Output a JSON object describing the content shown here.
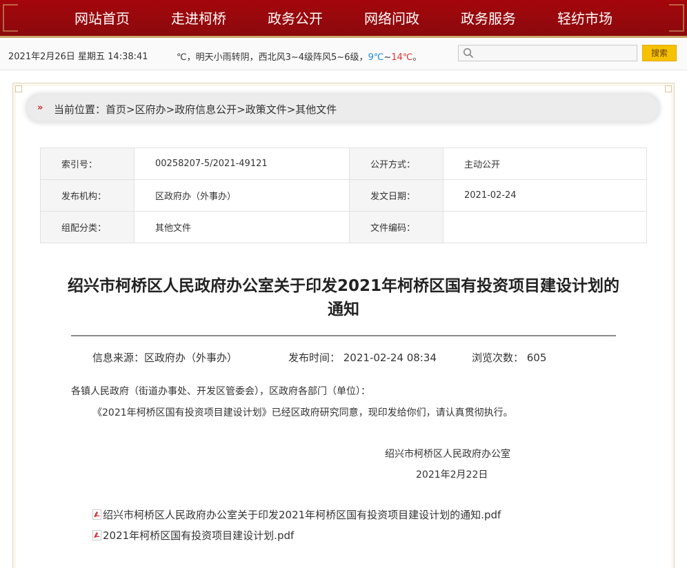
{
  "nav": {
    "items": [
      "网站首页",
      "走进柯桥",
      "政务公开",
      "网络问政",
      "政务服务",
      "轻纺市场"
    ]
  },
  "infobar": {
    "datetime": "2021年2月26日 星期五 14:38:41",
    "weather_prefix": "℃，明天小雨转阴，西北风3~4级阵风5~6级，",
    "temp_low": "9℃",
    "temp_sep": "~",
    "temp_high": "14℃",
    "weather_suffix": "。",
    "search_placeholder": "",
    "search_button": "搜索"
  },
  "breadcrumb": {
    "text": "当前位置：首页>区府办>政府信息公开>政策文件>其他文件"
  },
  "meta": {
    "rows": [
      {
        "k1": "索引号：",
        "v1": "00258207-5/2021-49121",
        "k2": "公开方式：",
        "v2": "主动公开"
      },
      {
        "k1": "发布机构：",
        "v1": "区政府办（外事办）",
        "k2": "发文日期：",
        "v2": "2021-02-24"
      },
      {
        "k1": "组配分类：",
        "v1": "其他文件",
        "k2": "文件编码：",
        "v2": ""
      }
    ]
  },
  "article": {
    "title": "绍兴市柯桥区人民政府办公室关于印发2021年柯桥区国有投资项目建设计划的通知",
    "source": "信息来源：区政府办（外事办）",
    "published": "发布时间： 2021-02-24 08:34",
    "views": "浏览次数： 605",
    "salutation": "各镇人民政府（街道办事处、开发区管委会），区政府各部门（单位）：",
    "body": "《2021年柯桥区国有投资项目建设计划》已经区政府研究同意，现印发给你们，请认真贯彻执行。",
    "signer": "绍兴市柯桥区人民政府办公室",
    "sign_date": "2021年2月22日"
  },
  "attachments": [
    "绍兴市柯桥区人民政府办公室关于印发2021年柯桥区国有投资项目建设计划的通知.pdf",
    "2021年柯桥区国有投资项目建设计划.pdf"
  ],
  "colors": {
    "nav_bg": "#a4060c",
    "temp_low": "#1c8bd8",
    "temp_high": "#e0322f",
    "search_button": "#f6c200",
    "breadcrumb_arrow": "#d0262b"
  }
}
